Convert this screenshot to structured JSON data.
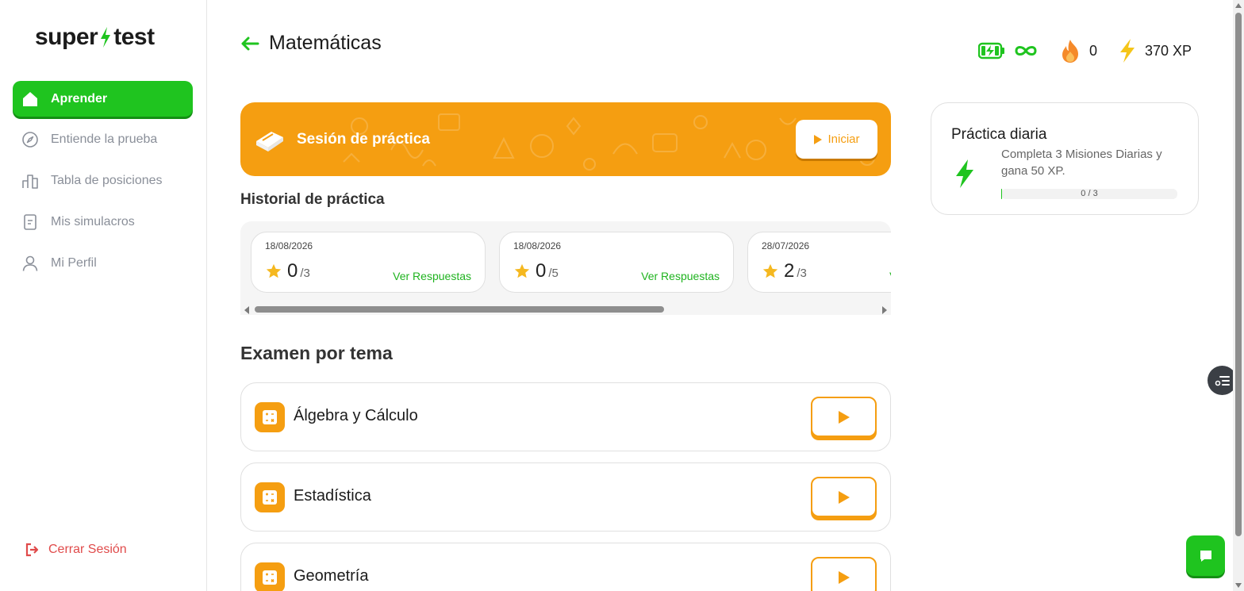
{
  "app": {
    "logo_left": "super",
    "logo_right": "test"
  },
  "sidebar": {
    "items": [
      {
        "label": "Aprender",
        "icon": "home-icon",
        "active": true
      },
      {
        "label": "Entiende la prueba",
        "icon": "compass-icon",
        "active": false
      },
      {
        "label": "Tabla de posiciones",
        "icon": "leaderboard-icon",
        "active": false
      },
      {
        "label": "Mis simulacros",
        "icon": "document-icon",
        "active": false
      },
      {
        "label": "Mi Perfil",
        "icon": "user-icon",
        "active": false
      }
    ],
    "logout_label": "Cerrar Sesión"
  },
  "header": {
    "title": "Matemáticas",
    "streak": "0",
    "xp": "370 XP",
    "energy": "∞"
  },
  "banner": {
    "title": "Sesión de práctica",
    "button_label": "Iniciar"
  },
  "history": {
    "title": "Historial de práctica",
    "link_label": "Ver Respuestas",
    "items": [
      {
        "date": "18/08/2026",
        "score": "0",
        "total": "/3"
      },
      {
        "date": "18/08/2026",
        "score": "0",
        "total": "/5"
      },
      {
        "date": "28/07/2026",
        "score": "2",
        "total": "/3"
      }
    ]
  },
  "topics": {
    "title": "Examen por tema",
    "items": [
      {
        "name": "Álgebra y Cálculo"
      },
      {
        "name": "Estadística"
      },
      {
        "name": "Geometría"
      }
    ]
  },
  "daily": {
    "title": "Práctica diaria",
    "description": "Completa 3 Misiones Diarias y gana 50 XP.",
    "progress_text": "0 / 3",
    "progress_fraction": 0.0
  },
  "colors": {
    "brand_green": "#1fc41f",
    "accent_orange": "#f59e11",
    "logout_red": "#e04b4b"
  }
}
